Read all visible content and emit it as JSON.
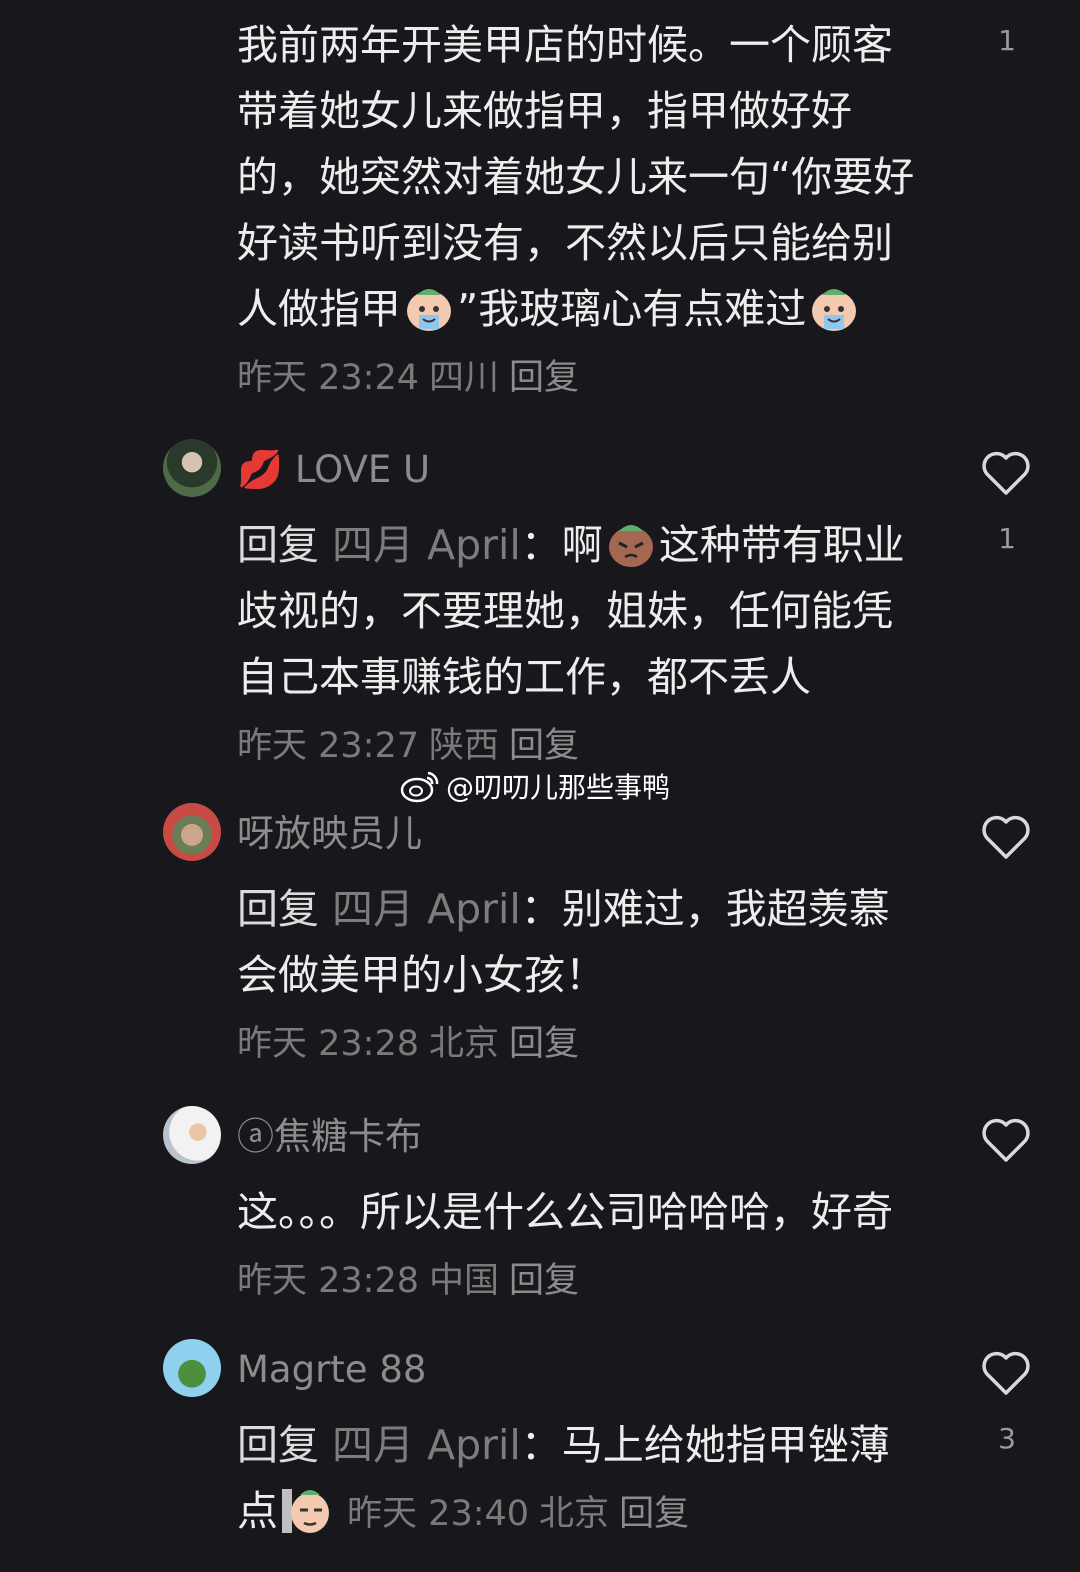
{
  "watermark": {
    "text": "@叨叨儿那些事鸭",
    "icon": "weibo-icon"
  },
  "comments": [
    {
      "id": "c0",
      "text": "我前两年开美甲店的时候。一个顾客带着她女儿来做指甲，指甲做好好的，她突然对着她女儿来一句“你要好好读书听到没有，不然以后只能给别人做指甲",
      "text_tail": "”我玻璃心有点难过",
      "time": "昨天 23:24",
      "location": "四川",
      "reply_label": "回复",
      "likes": "1"
    },
    {
      "id": "c1",
      "username": "💋    LOVE    U",
      "reply_prefix": "回复",
      "reply_target": "四月 April",
      "text_head": "：啊",
      "text": "这种带有职业歧视的，不要理她，姐妹，任何能凭自己本事赚钱的工作，都不丢人",
      "time": "昨天 23:27",
      "location": "陕西",
      "reply_label": "回复",
      "likes": "1"
    },
    {
      "id": "c2",
      "username": "呀放映员儿",
      "reply_prefix": "回复",
      "reply_target": "四月 April",
      "text": "：别难过，我超羡慕会做美甲的小女孩！",
      "time": "昨天 23:28",
      "location": "北京",
      "reply_label": "回复",
      "likes": ""
    },
    {
      "id": "c3",
      "username": "ⓐ焦糖卡布",
      "text": "这。。。所以是什么公司哈哈哈，好奇",
      "time": "昨天 23:28",
      "location": "中国",
      "reply_label": "回复",
      "likes": ""
    },
    {
      "id": "c4",
      "username": "Magrte 88",
      "reply_prefix": "回复",
      "reply_target": "四月 April",
      "text": "：马上给她指甲锉薄点",
      "time": "昨天 23:40",
      "location": "北京",
      "reply_label": "回复",
      "likes": "3"
    }
  ],
  "colors": {
    "background": "#17171c",
    "text": "#ededed",
    "meta": "#7a7a7a",
    "heart_stroke": "#d9d9d9"
  }
}
